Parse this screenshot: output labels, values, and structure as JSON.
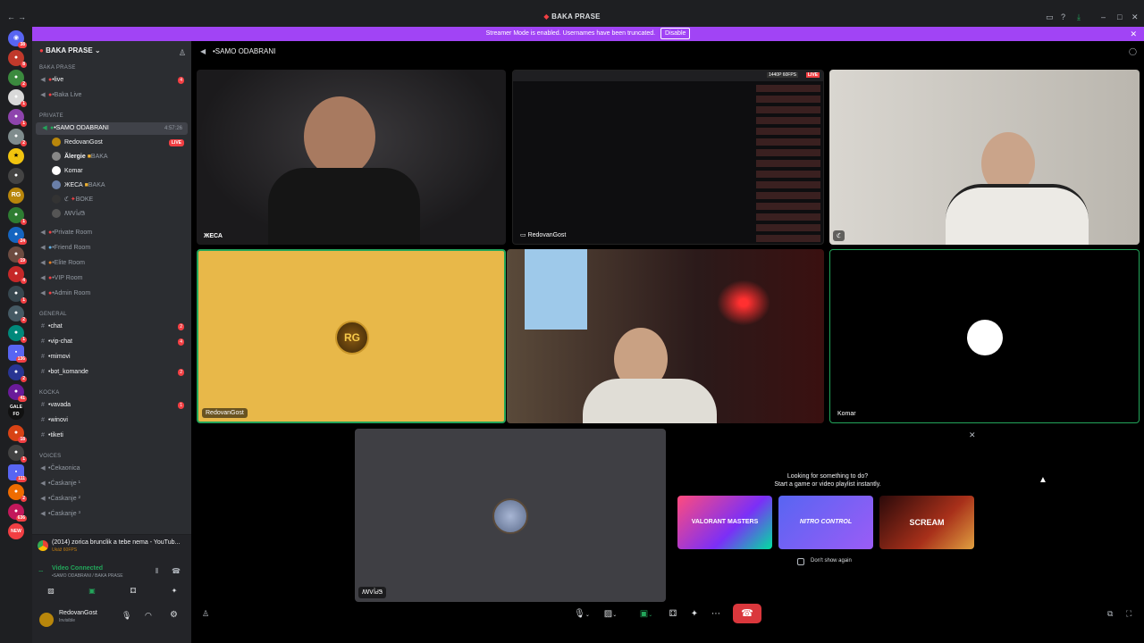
{
  "window": {
    "title": "BAKA PRASE"
  },
  "banner": {
    "text": "Streamer Mode is enabled. Usernames have been truncated.",
    "disable": "Disable"
  },
  "servers": [
    "38",
    "8",
    "2",
    "1",
    "1",
    "2",
    "RG",
    "1",
    "24",
    "19",
    "4",
    "1",
    "2",
    "1",
    "136",
    "2",
    "41",
    "1",
    "GALE FO",
    "18",
    "1",
    "111",
    "2",
    "636",
    "NEW"
  ],
  "guild": {
    "name": "BAKA PRASE"
  },
  "channels": {
    "cat_main": "BAKA PRASE",
    "live": "•live",
    "live_count": "4",
    "baka_live": "•Baka Live",
    "cat_private": "PRIVATE",
    "samo": "•SAMO ODABRANI",
    "samo_time": "4:57:26",
    "members": [
      "RedovanGost",
      "Ălergie",
      "Komar",
      "ЖЕСА",
      "ℭ",
      "ꟿᏙỈᏧᏕ"
    ],
    "member_tags": {
      "allergie": "BAKA",
      "zheca": "BAKA",
      "c": "BOKE"
    },
    "live_label": "LIVE",
    "rooms": [
      "•Private Room",
      "•Friend Room",
      "•Elite Room",
      "•VIP Room",
      "•Admin Room"
    ],
    "cat_general": "GENERAL",
    "general": [
      {
        "name": "•chat",
        "count": "2"
      },
      {
        "name": "•vip-chat",
        "count": "4"
      },
      {
        "name": "•mimovi",
        "count": ""
      },
      {
        "name": "•bot_komande",
        "count": "2"
      }
    ],
    "cat_kocka": "KOCKA",
    "kocka": [
      {
        "name": "•vavada",
        "count": "1"
      },
      {
        "name": "•winovi",
        "count": ""
      },
      {
        "name": "•tiketi",
        "count": ""
      }
    ],
    "cat_voices": "VOICES",
    "voices": [
      "•Čekaonica",
      "•Ćaskanje ¹",
      "•Ćaskanje ²",
      "•Ćaskanje ³"
    ]
  },
  "activity": {
    "title": "(2014) zorica brunclik a tebe nema - YouTub...",
    "sub": "Ukáž 60FPS"
  },
  "voice": {
    "status": "Video Connected",
    "channel": "•SAMO ODABRANI / BAKA PRASE"
  },
  "user": {
    "name": "RedovanGost",
    "status": "Invisible"
  },
  "header": {
    "channel": "•SAMO ODABRANI"
  },
  "tiles": {
    "t1": "ЖЕСА",
    "t2": "RedovanGost",
    "t2_badge": "1440P 60FPS",
    "t2_live": "LIVE",
    "t3": "ℭ",
    "t4": "RedovanGost",
    "t4_logo": "RG",
    "t6": "Komar",
    "t7": "ꟿᏙỈᏧᏕ"
  },
  "popup": {
    "line1": "Looking for something to do?",
    "line2": "Start a game or video playlist instantly.",
    "game1": "VALORANT MASTERS",
    "game2": "NITRO CONTROL",
    "game3": "SCREAM",
    "dont_show": "Don't show again",
    "close": "✕"
  }
}
